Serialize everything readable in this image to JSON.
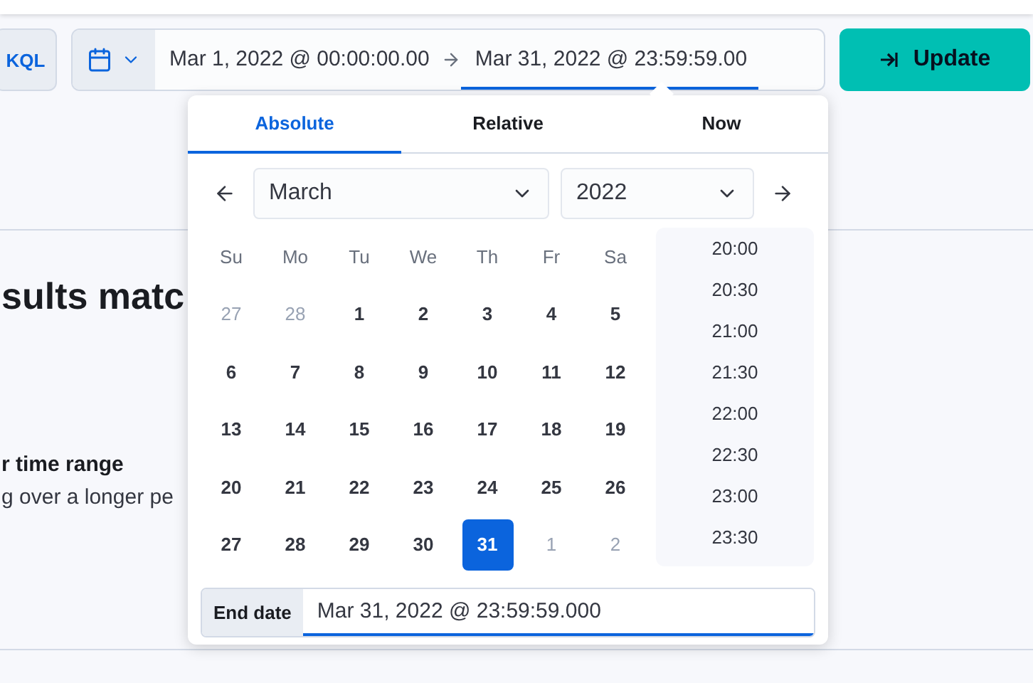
{
  "query_language": "KQL",
  "date_range": {
    "start": "Mar 1, 2022 @ 00:00:00.00",
    "end": "Mar 31, 2022 @ 23:59:59.00"
  },
  "update_button": "Update",
  "background": {
    "heading": "sults matc",
    "subheading": "r time range",
    "text": "g over a longer pe"
  },
  "popover": {
    "tabs": [
      {
        "label": "Absolute",
        "selected": true
      },
      {
        "label": "Relative",
        "selected": false
      },
      {
        "label": "Now",
        "selected": false
      }
    ],
    "month": "March",
    "year": "2022",
    "weekdays": [
      "Su",
      "Mo",
      "Tu",
      "We",
      "Th",
      "Fr",
      "Sa"
    ],
    "days": [
      {
        "label": "27",
        "outside": true,
        "selected": false
      },
      {
        "label": "28",
        "outside": true,
        "selected": false
      },
      {
        "label": "1",
        "outside": false,
        "selected": false
      },
      {
        "label": "2",
        "outside": false,
        "selected": false
      },
      {
        "label": "3",
        "outside": false,
        "selected": false
      },
      {
        "label": "4",
        "outside": false,
        "selected": false
      },
      {
        "label": "5",
        "outside": false,
        "selected": false
      },
      {
        "label": "6",
        "outside": false,
        "selected": false
      },
      {
        "label": "7",
        "outside": false,
        "selected": false
      },
      {
        "label": "8",
        "outside": false,
        "selected": false
      },
      {
        "label": "9",
        "outside": false,
        "selected": false
      },
      {
        "label": "10",
        "outside": false,
        "selected": false
      },
      {
        "label": "11",
        "outside": false,
        "selected": false
      },
      {
        "label": "12",
        "outside": false,
        "selected": false
      },
      {
        "label": "13",
        "outside": false,
        "selected": false
      },
      {
        "label": "14",
        "outside": false,
        "selected": false
      },
      {
        "label": "15",
        "outside": false,
        "selected": false
      },
      {
        "label": "16",
        "outside": false,
        "selected": false
      },
      {
        "label": "17",
        "outside": false,
        "selected": false
      },
      {
        "label": "18",
        "outside": false,
        "selected": false
      },
      {
        "label": "19",
        "outside": false,
        "selected": false
      },
      {
        "label": "20",
        "outside": false,
        "selected": false
      },
      {
        "label": "21",
        "outside": false,
        "selected": false
      },
      {
        "label": "22",
        "outside": false,
        "selected": false
      },
      {
        "label": "23",
        "outside": false,
        "selected": false
      },
      {
        "label": "24",
        "outside": false,
        "selected": false
      },
      {
        "label": "25",
        "outside": false,
        "selected": false
      },
      {
        "label": "26",
        "outside": false,
        "selected": false
      },
      {
        "label": "27",
        "outside": false,
        "selected": false
      },
      {
        "label": "28",
        "outside": false,
        "selected": false
      },
      {
        "label": "29",
        "outside": false,
        "selected": false
      },
      {
        "label": "30",
        "outside": false,
        "selected": false
      },
      {
        "label": "31",
        "outside": false,
        "selected": true
      },
      {
        "label": "1",
        "outside": true,
        "selected": false
      },
      {
        "label": "2",
        "outside": true,
        "selected": false
      }
    ],
    "times": [
      "20:00",
      "20:30",
      "21:00",
      "21:30",
      "22:00",
      "22:30",
      "23:00",
      "23:30"
    ],
    "end_date": {
      "label": "End date",
      "value": "Mar 31, 2022 @ 23:59:59.000"
    }
  }
}
